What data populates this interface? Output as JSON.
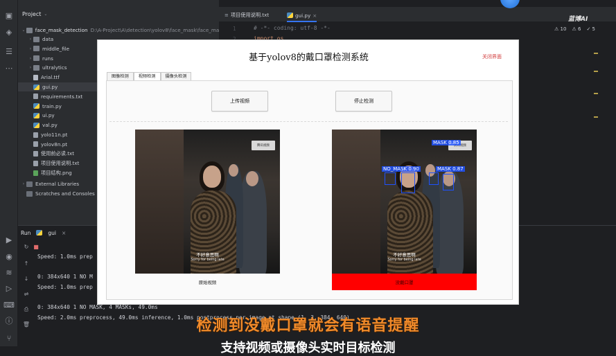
{
  "project": {
    "header": "Project",
    "root_name": "face_mask_detection",
    "root_path": "D:\\A-Project\\A\\detection\\yolov8\\face_mask\\face_mas",
    "items": [
      {
        "label": "data",
        "kind": "folder"
      },
      {
        "label": "middle_file",
        "kind": "folder"
      },
      {
        "label": "runs",
        "kind": "folder"
      },
      {
        "label": "ultralytics",
        "kind": "folder"
      },
      {
        "label": "Arial.ttf",
        "kind": "ttf"
      },
      {
        "label": "gui.py",
        "kind": "py"
      },
      {
        "label": "requirements.txt",
        "kind": "txt"
      },
      {
        "label": "train.py",
        "kind": "py"
      },
      {
        "label": "ui.py",
        "kind": "py"
      },
      {
        "label": "val.py",
        "kind": "py"
      },
      {
        "label": "yolo11n.pt",
        "kind": "txt"
      },
      {
        "label": "yolov8n.pt",
        "kind": "txt"
      },
      {
        "label": "使用前必读.txt",
        "kind": "txt"
      },
      {
        "label": "项目使用说明.txt",
        "kind": "txt"
      },
      {
        "label": "项目结构.png",
        "kind": "png"
      }
    ],
    "external": "External Libraries",
    "scratches": "Scratches and Consoles"
  },
  "editor": {
    "tabs": [
      "项目使用说明.txt",
      "gui.py"
    ],
    "line_numbers": [
      "1",
      "2"
    ],
    "code_lines": [
      "# -*- coding: utf-8 -*-",
      "import os"
    ],
    "warnings": {
      "warn": "10",
      "weak": "6",
      "typo": "5"
    }
  },
  "run": {
    "label": "Run",
    "config": "gui",
    "lines": [
      "Speed: 1.0ms prep",
      "",
      "0: 384x640 1 NO M",
      "Speed: 1.0ms prep",
      "",
      "0: 384x640 1 NO MASK, 4 MASKs, 49.0ms",
      "Speed: 2.0ms preprocess, 49.0ms inference, 1.0ms postprocess per image at shape (1, 3, 384, 640)"
    ]
  },
  "app": {
    "title": "基于yolov8的戴口罩检测系统",
    "close_label": "关闭界面",
    "tabs": [
      "图像检测",
      "视频检测",
      "摄像头检测"
    ],
    "active_tab": 1,
    "upload_button": "上传视频",
    "stop_button": "停止检测",
    "original_caption": "原始视频",
    "result_caption": "没戴口罩",
    "subtitle_cn": "不好意思啊",
    "subtitle_en": "Sorry for being late",
    "channel_logo": "腾讯视频",
    "detections": [
      {
        "label": "MASK 0.85"
      },
      {
        "label": "NO_MASK 0.90"
      },
      {
        "label": "MASK 0.87"
      }
    ]
  },
  "overlay": {
    "caption": "检测到没戴口罩就会有语音提醒",
    "caption2": "支持视频或摄像头实时目标检测",
    "watermark": "蓝博AI"
  },
  "colors": {
    "accent": "#3574f0",
    "alert": "#ff0000",
    "caption": "#f08a2a"
  }
}
